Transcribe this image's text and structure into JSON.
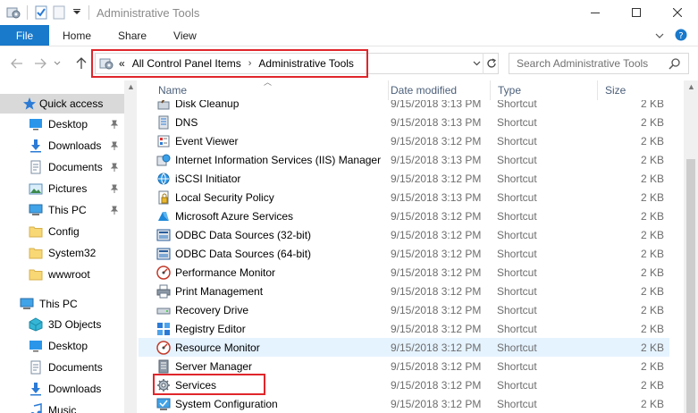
{
  "window": {
    "title": "Administrative Tools",
    "buttons": [
      "minimize-icon",
      "maximize-icon",
      "close-icon"
    ]
  },
  "ribbon": {
    "file": "File",
    "tabs": [
      "Home",
      "Share",
      "View"
    ]
  },
  "address": {
    "overflow": "«",
    "crumbs": [
      "All Control Panel Items",
      "Administrative Tools"
    ]
  },
  "search": {
    "placeholder": "Search Administrative Tools"
  },
  "columns": {
    "name": "Name",
    "date": "Date modified",
    "type": "Type",
    "size": "Size"
  },
  "nav": {
    "quick_access": "Quick access",
    "quick_items": [
      {
        "label": "Desktop",
        "icon": "desktop-icon",
        "pinned": true
      },
      {
        "label": "Downloads",
        "icon": "downloads-icon",
        "pinned": true
      },
      {
        "label": "Documents",
        "icon": "documents-icon",
        "pinned": true
      },
      {
        "label": "Pictures",
        "icon": "pictures-icon",
        "pinned": true
      },
      {
        "label": "This PC",
        "icon": "computer-icon",
        "pinned": true
      },
      {
        "label": "Config",
        "icon": "folder-icon",
        "pinned": false
      },
      {
        "label": "System32",
        "icon": "folder-icon",
        "pinned": false
      },
      {
        "label": "wwwroot",
        "icon": "folder-icon",
        "pinned": false
      }
    ],
    "this_pc": "This PC",
    "pc_items": [
      {
        "label": "3D Objects",
        "icon": "3d-objects-icon"
      },
      {
        "label": "Desktop",
        "icon": "desktop-icon"
      },
      {
        "label": "Documents",
        "icon": "documents-icon"
      },
      {
        "label": "Downloads",
        "icon": "downloads-icon"
      },
      {
        "label": "Music",
        "icon": "music-icon"
      }
    ]
  },
  "files": [
    {
      "name": "Disk Cleanup",
      "date": "9/15/2018 3:13 PM",
      "type": "Shortcut",
      "size": "2 KB",
      "icon": "disk-cleanup-icon"
    },
    {
      "name": "DNS",
      "date": "9/15/2018 3:13 PM",
      "type": "Shortcut",
      "size": "2 KB",
      "icon": "dns-icon"
    },
    {
      "name": "Event Viewer",
      "date": "9/15/2018 3:12 PM",
      "type": "Shortcut",
      "size": "2 KB",
      "icon": "event-viewer-icon"
    },
    {
      "name": "Internet Information Services (IIS) Manager",
      "date": "9/15/2018 3:13 PM",
      "type": "Shortcut",
      "size": "2 KB",
      "icon": "iis-icon"
    },
    {
      "name": "iSCSI Initiator",
      "date": "9/15/2018 3:12 PM",
      "type": "Shortcut",
      "size": "2 KB",
      "icon": "iscsi-icon"
    },
    {
      "name": "Local Security Policy",
      "date": "9/15/2018 3:13 PM",
      "type": "Shortcut",
      "size": "2 KB",
      "icon": "security-policy-icon"
    },
    {
      "name": "Microsoft Azure Services",
      "date": "9/15/2018 3:12 PM",
      "type": "Shortcut",
      "size": "2 KB",
      "icon": "azure-icon"
    },
    {
      "name": "ODBC Data Sources (32-bit)",
      "date": "9/15/2018 3:12 PM",
      "type": "Shortcut",
      "size": "2 KB",
      "icon": "odbc-icon"
    },
    {
      "name": "ODBC Data Sources (64-bit)",
      "date": "9/15/2018 3:12 PM",
      "type": "Shortcut",
      "size": "2 KB",
      "icon": "odbc-icon"
    },
    {
      "name": "Performance Monitor",
      "date": "9/15/2018 3:12 PM",
      "type": "Shortcut",
      "size": "2 KB",
      "icon": "performance-monitor-icon"
    },
    {
      "name": "Print Management",
      "date": "9/15/2018 3:12 PM",
      "type": "Shortcut",
      "size": "2 KB",
      "icon": "printer-icon"
    },
    {
      "name": "Recovery Drive",
      "date": "9/15/2018 3:12 PM",
      "type": "Shortcut",
      "size": "2 KB",
      "icon": "recovery-drive-icon"
    },
    {
      "name": "Registry Editor",
      "date": "9/15/2018 3:12 PM",
      "type": "Shortcut",
      "size": "2 KB",
      "icon": "registry-editor-icon"
    },
    {
      "name": "Resource Monitor",
      "date": "9/15/2018 3:12 PM",
      "type": "Shortcut",
      "size": "2 KB",
      "icon": "resource-monitor-icon"
    },
    {
      "name": "Server Manager",
      "date": "9/15/2018 3:12 PM",
      "type": "Shortcut",
      "size": "2 KB",
      "icon": "server-manager-icon"
    },
    {
      "name": "Services",
      "date": "9/15/2018 3:12 PM",
      "type": "Shortcut",
      "size": "2 KB",
      "icon": "services-icon"
    },
    {
      "name": "System Configuration",
      "date": "9/15/2018 3:12 PM",
      "type": "Shortcut",
      "size": "2 KB",
      "icon": "system-configuration-icon"
    }
  ],
  "colors": {
    "accent": "#1979ca",
    "highlight": "#e0262b",
    "hover_row": "#e5f3ff"
  }
}
